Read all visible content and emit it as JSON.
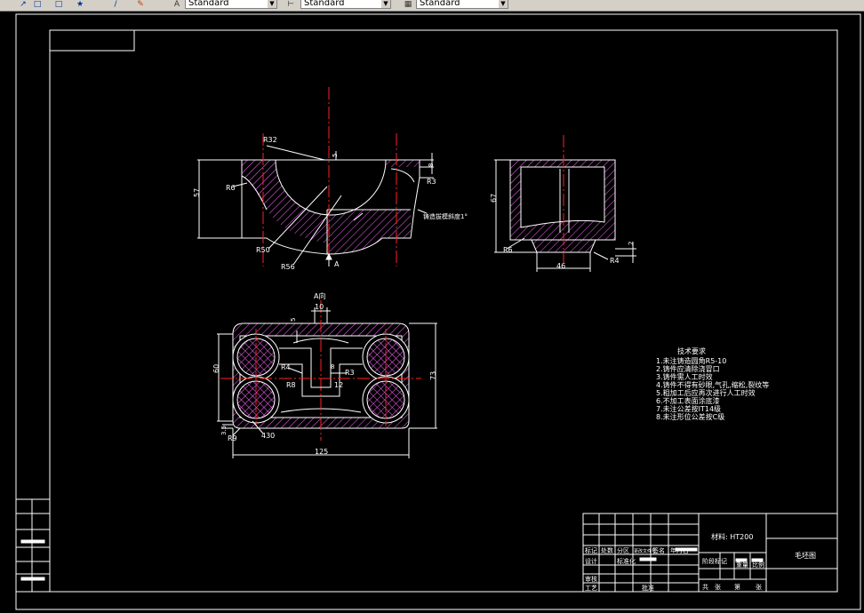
{
  "toolbar": {
    "text_style": "Standard",
    "dim_style": "Standard",
    "table_style": "Standard"
  },
  "drawing": {
    "colors": {
      "background": "#000000",
      "line": "#ffffff",
      "center": "#ff2020",
      "hatch": "#ff66ff"
    },
    "front_view": {
      "r32": "R32",
      "d5": "5",
      "d8": "8",
      "r3": "R3",
      "r6": "R6",
      "d57": "57",
      "r50": "R50",
      "r56": "R56",
      "a": "A",
      "slope": "铸造拔模斜度1°"
    },
    "side_view": {
      "d67": "67",
      "r6": "R6",
      "d46": "46",
      "r4": "R4",
      "d2": "2"
    },
    "a_view": {
      "title": "A向",
      "d10": "10",
      "d5": "5",
      "r4": "R4",
      "d8": "8",
      "r3": "R3",
      "r8": "R8",
      "d12": "12",
      "d60": "60",
      "d73": "73",
      "d3_5": "3.5",
      "r9": "R9",
      "d430": "430",
      "d125": "125"
    },
    "tech_req": {
      "title": "技术要求",
      "items": [
        "1.未注铸造圆角R5-10",
        "2.铸件应清除浇冒口",
        "3.铸件需人工时效",
        "4.铸件不得有砂眼,气孔,缩松,裂纹等",
        "5.粗加工后应再次进行人工时效",
        "6.不加工表面涂底漆",
        "7.未注公差按IT14级",
        "8.未注形位公差按C级"
      ]
    },
    "title_block": {
      "material": "材料: HT200",
      "drawing_name": "毛坯图",
      "labels": [
        "标记",
        "处数",
        "分区",
        "更改文件号",
        "签名",
        "年月日",
        "设计",
        "标准化",
        "审核",
        "工艺",
        "批准",
        "阶段标记",
        "重量",
        "比例",
        "共",
        "张",
        "第",
        "张"
      ]
    }
  }
}
